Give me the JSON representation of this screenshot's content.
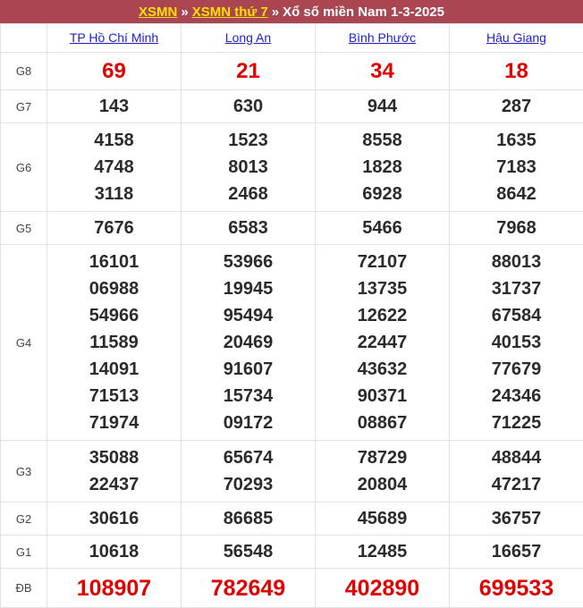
{
  "header": {
    "link1": "XSMN",
    "sep1": "»",
    "link2": "XSMN thứ 7",
    "sep2": "»",
    "title": "Xổ số miền Nam 1-3-2025"
  },
  "provinces": [
    "TP Hồ Chí Minh",
    "Long An",
    "Bình Phước",
    "Hậu Giang"
  ],
  "prizes": [
    {
      "label": "G8",
      "values": [
        [
          "69"
        ],
        [
          "21"
        ],
        [
          "34"
        ],
        [
          "18"
        ]
      ]
    },
    {
      "label": "G7",
      "values": [
        [
          "143"
        ],
        [
          "630"
        ],
        [
          "944"
        ],
        [
          "287"
        ]
      ]
    },
    {
      "label": "G6",
      "values": [
        [
          "4158",
          "4748",
          "3118"
        ],
        [
          "1523",
          "8013",
          "2468"
        ],
        [
          "8558",
          "1828",
          "6928"
        ],
        [
          "1635",
          "7183",
          "8642"
        ]
      ]
    },
    {
      "label": "G5",
      "values": [
        [
          "7676"
        ],
        [
          "6583"
        ],
        [
          "5466"
        ],
        [
          "7968"
        ]
      ]
    },
    {
      "label": "G4",
      "values": [
        [
          "16101",
          "06988",
          "54966",
          "11589",
          "14091",
          "71513",
          "71974"
        ],
        [
          "53966",
          "19945",
          "95494",
          "20469",
          "91607",
          "15734",
          "09172"
        ],
        [
          "72107",
          "13735",
          "12622",
          "22447",
          "43632",
          "90371",
          "08867"
        ],
        [
          "88013",
          "31737",
          "67584",
          "40153",
          "77679",
          "24346",
          "71225"
        ]
      ]
    },
    {
      "label": "G3",
      "values": [
        [
          "35088",
          "22437"
        ],
        [
          "65674",
          "70293"
        ],
        [
          "78729",
          "20804"
        ],
        [
          "48844",
          "47217"
        ]
      ]
    },
    {
      "label": "G2",
      "values": [
        [
          "30616"
        ],
        [
          "86685"
        ],
        [
          "45689"
        ],
        [
          "36757"
        ]
      ]
    },
    {
      "label": "G1",
      "values": [
        [
          "10618"
        ],
        [
          "56548"
        ],
        [
          "12485"
        ],
        [
          "16657"
        ]
      ]
    },
    {
      "label": "ĐB",
      "values": [
        [
          "108907"
        ],
        [
          "782649"
        ],
        [
          "402890"
        ],
        [
          "699533"
        ]
      ]
    }
  ]
}
